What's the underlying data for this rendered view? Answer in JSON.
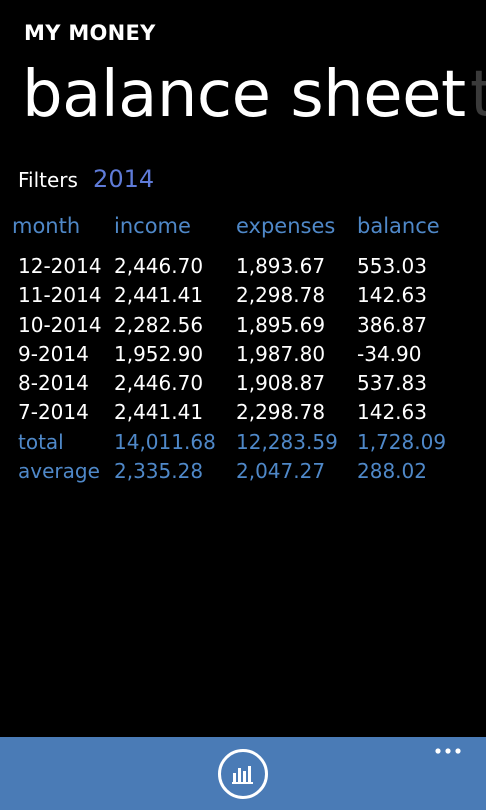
{
  "app": {
    "title": "MY MONEY"
  },
  "pivot": {
    "current": "balance sheet",
    "next": "t"
  },
  "filters": {
    "label": "Filters",
    "value": "2014"
  },
  "table": {
    "columns": [
      "month",
      "income",
      "expenses",
      "balance"
    ],
    "rows": [
      [
        "12-2014",
        "2,446.70",
        "1,893.67",
        "553.03"
      ],
      [
        "11-2014",
        "2,441.41",
        "2,298.78",
        "142.63"
      ],
      [
        "10-2014",
        "2,282.56",
        "1,895.69",
        "386.87"
      ],
      [
        "9-2014",
        "1,952.90",
        "1,987.80",
        "-34.90"
      ],
      [
        "8-2014",
        "2,446.70",
        "1,908.87",
        "537.83"
      ],
      [
        "7-2014",
        "2,441.41",
        "2,298.78",
        "142.63"
      ]
    ],
    "summary": [
      [
        "total",
        "14,011.68",
        "12,283.59",
        "1,728.09"
      ],
      [
        "average",
        "2,335.28",
        "2,047.27",
        "288.02"
      ]
    ]
  },
  "appbar": {
    "button_icon": "bar-chart-icon",
    "more_icon": "ellipsis-icon"
  },
  "colors": {
    "accent": "#5f7bd8",
    "header_text": "#4f88c8",
    "appbar": "#4a7bb6",
    "background": "#000000"
  }
}
